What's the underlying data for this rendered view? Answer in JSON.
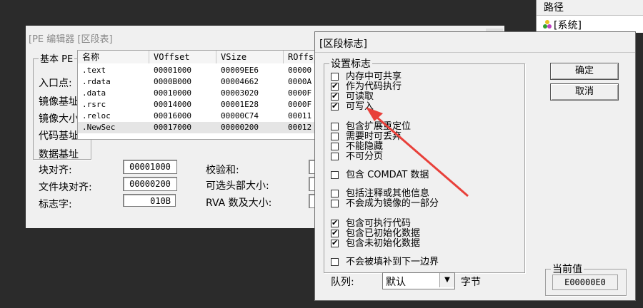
{
  "top_right_panel": {
    "header": "路径",
    "item": "[系统]"
  },
  "pe_editor": {
    "title": "[PE 编辑器 [区段表]",
    "group_label": "基本 PE",
    "labels": [
      "入口点:",
      "镜像基址",
      "镜像大小",
      "代码基址",
      "数据基址"
    ],
    "block_align": {
      "label": "块对齐:",
      "value": "00001000"
    },
    "file_align": {
      "label": "文件块对齐:",
      "value": "00000200"
    },
    "flags": {
      "label": "标志字:",
      "value": "010B"
    },
    "checksum": {
      "label": "校验和:"
    },
    "opt_header": {
      "label": "可选头部大小:"
    },
    "rva": {
      "label": "RVA 数及大小:"
    }
  },
  "section_table": {
    "columns": [
      "名称",
      "VOffset",
      "VSize",
      "ROffs"
    ],
    "rows": [
      [
        ".text",
        "00001000",
        "00009EE6",
        "00000"
      ],
      [
        ".rdata",
        "0000B000",
        "00004662",
        "0000A"
      ],
      [
        ".data",
        "00010000",
        "00003020",
        "0000F"
      ],
      [
        ".rsrc",
        "00014000",
        "00001E28",
        "0000F"
      ],
      [
        ".reloc",
        "00016000",
        "00000C74",
        "00011"
      ],
      [
        ".NewSec",
        "00017000",
        "00000200",
        "00012"
      ]
    ],
    "selected_row": 5
  },
  "flags_dialog": {
    "title": "[区段标志]",
    "group": "设置标志",
    "ok": "确定",
    "cancel": "取消",
    "flags": [
      {
        "label": "内存中可共享",
        "checked": false
      },
      {
        "label": "作为代码执行",
        "checked": true
      },
      {
        "label": "可读取",
        "checked": true
      },
      {
        "label": "可写入",
        "checked": true
      },
      {
        "label": "包含扩展重定位",
        "checked": false
      },
      {
        "label": "需要时可丢弃",
        "checked": false
      },
      {
        "label": "不能隐藏",
        "checked": false
      },
      {
        "label": "不可分页",
        "checked": false
      },
      {
        "label": "包含 COMDAT 数据",
        "checked": false
      },
      {
        "label": "包括注释或其他信息",
        "checked": false
      },
      {
        "label": "不会成为镜像的一部分",
        "checked": false
      },
      {
        "label": "包含可执行代码",
        "checked": true
      },
      {
        "label": "包含已初始化数据",
        "checked": true
      },
      {
        "label": "包含未初始化数据",
        "checked": true
      },
      {
        "label": "不会被填补到下一边界",
        "checked": false
      }
    ],
    "queue_label": "队列:",
    "queue_value": "默认",
    "queue_unit": "字节",
    "current_label": "当前值",
    "current_value": "E00000E0"
  },
  "colors": {
    "arrow": "#e8403a",
    "desktop": "#2b2b2b",
    "window": "#f0f0f0"
  }
}
